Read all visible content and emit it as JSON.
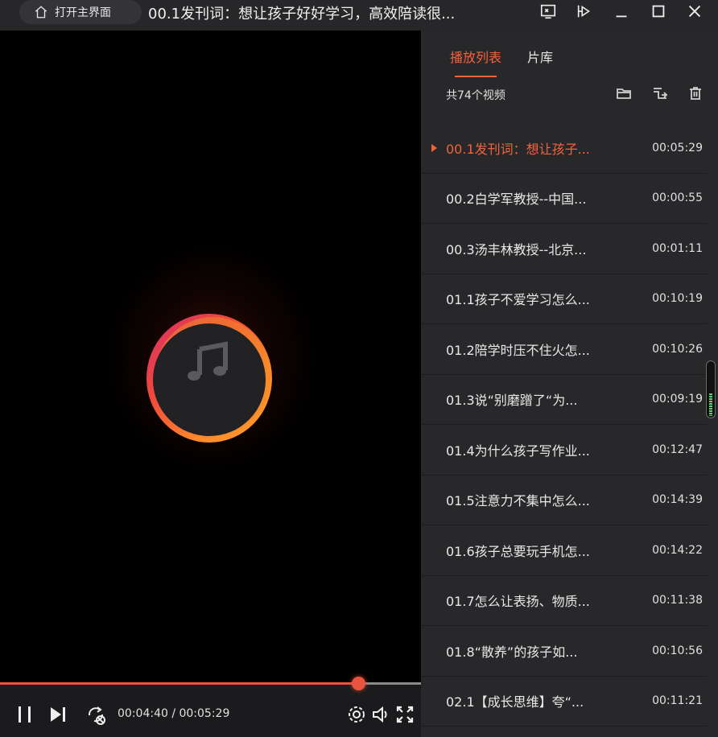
{
  "titlebar": {
    "home_label": "打开主界面",
    "title": "00.1发刊词：想让孩子好好学习，高效陪读很...",
    "icons": [
      "screen-icon",
      "pin-icon",
      "minimize-icon",
      "maximize-icon",
      "close-icon"
    ]
  },
  "player": {
    "time_display": "00:04:40 / 00:05:29",
    "progress": 0.851,
    "icons": [
      "pause-icon",
      "next-icon",
      "loop-icon",
      "settings-icon",
      "volume-icon",
      "fullscreen-icon"
    ]
  },
  "panel": {
    "tabs": [
      {
        "label": "播放列表",
        "active": true
      },
      {
        "label": "片库",
        "active": false
      }
    ],
    "count": "共74个视频",
    "tool_icons": [
      "folder-icon",
      "playlist-icon",
      "trash-icon"
    ],
    "items": [
      {
        "title": "00.1发刊词：想让孩子...",
        "duration": "00:05:29",
        "active": true
      },
      {
        "title": "00.2白学军教授--中国...",
        "duration": "00:00:55",
        "active": false
      },
      {
        "title": "00.3汤丰林教授--北京...",
        "duration": "00:01:11",
        "active": false
      },
      {
        "title": "01.1孩子不爱学习怎么...",
        "duration": "00:10:19",
        "active": false
      },
      {
        "title": "01.2陪学时压不住火怎...",
        "duration": "00:10:26",
        "active": false
      },
      {
        "title": "01.3说“别磨蹭了“为...",
        "duration": "00:09:19",
        "active": false
      },
      {
        "title": "01.4为什么孩子写作业...",
        "duration": "00:12:47",
        "active": false
      },
      {
        "title": "01.5注意力不集中怎么...",
        "duration": "00:14:39",
        "active": false
      },
      {
        "title": "01.6孩子总要玩手机怎...",
        "duration": "00:14:22",
        "active": false
      },
      {
        "title": "01.7怎么让表扬、物质...",
        "duration": "00:11:38",
        "active": false
      },
      {
        "title": "01.8“散养”的孩子如...",
        "duration": "00:10:56",
        "active": false
      },
      {
        "title": "02.1【成长思维】夸“...",
        "duration": "00:11:21",
        "active": false
      }
    ]
  },
  "colors": {
    "accent": "#f0643c",
    "progress": "#e8553f",
    "panel_bg": "#28282b",
    "video_bg": "#000000"
  }
}
